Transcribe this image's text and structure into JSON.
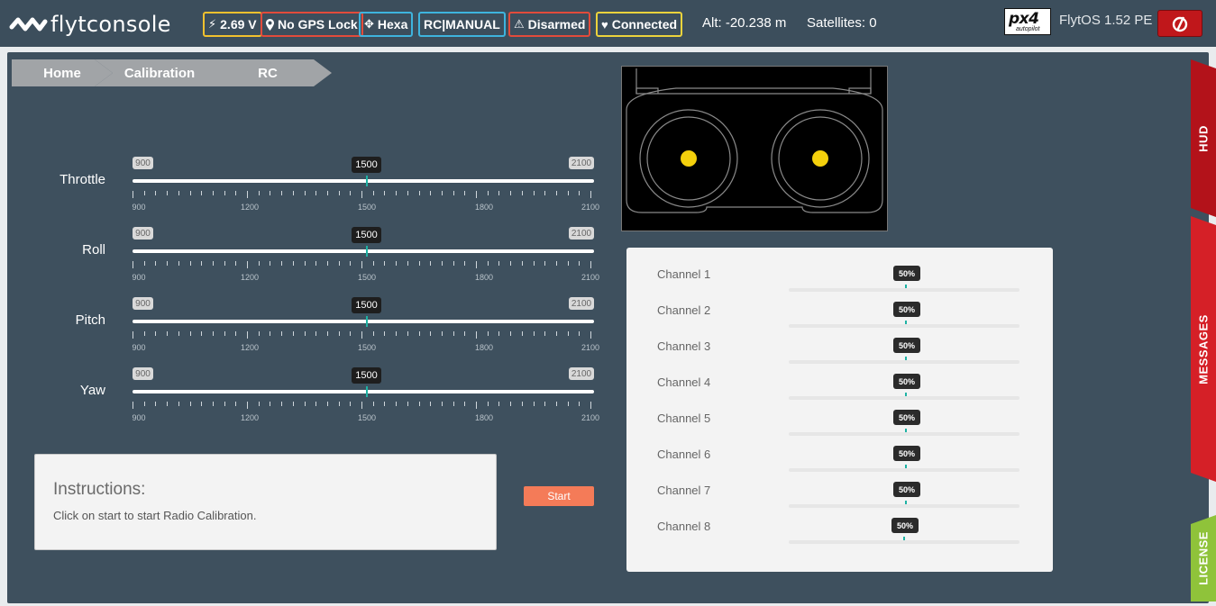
{
  "header": {
    "logo_text": "flytconsole",
    "battery": "2.69 V",
    "gps": "No GPS Lock",
    "frame": "Hexa",
    "mode": "RC|MANUAL",
    "arm_state": "Disarmed",
    "link": "Connected",
    "altitude": "Alt: -20.238 m",
    "satellites": "Satellites: 0",
    "autopilot_logo_main": "px4",
    "autopilot_logo_sub": "autopilot",
    "os_version": "FlytOS 1.52 PE"
  },
  "breadcrumb": [
    "Home",
    "Calibration",
    "RC"
  ],
  "sliders": [
    {
      "label": "Throttle",
      "min": "900",
      "max": "2100",
      "value": "1500"
    },
    {
      "label": "Roll",
      "min": "900",
      "max": "2100",
      "value": "1500"
    },
    {
      "label": "Pitch",
      "min": "900",
      "max": "2100",
      "value": "1500"
    },
    {
      "label": "Yaw",
      "min": "900",
      "max": "2100",
      "value": "1500"
    }
  ],
  "slider_scale": [
    "900",
    "1200",
    "1500",
    "1800",
    "2100"
  ],
  "instructions": {
    "title": "Instructions:",
    "text": "Click on start to start Radio Calibration."
  },
  "start_label": "Start",
  "channels": [
    {
      "label": "Channel 1",
      "value": "50%"
    },
    {
      "label": "Channel 2",
      "value": "50%"
    },
    {
      "label": "Channel 3",
      "value": "50%"
    },
    {
      "label": "Channel 4",
      "value": "50%"
    },
    {
      "label": "Channel 5",
      "value": "50%"
    },
    {
      "label": "Channel 6",
      "value": "50%"
    },
    {
      "label": "Channel 7",
      "value": "50%"
    },
    {
      "label": "Channel 8",
      "value": "50%"
    }
  ],
  "side_tabs": {
    "hud": "HUD",
    "messages": "MESSAGES",
    "license": "LICENSE"
  },
  "colors": {
    "topbar": "#3c4e5c",
    "panel": "#3e505e",
    "accent": "#1fb3a4",
    "start_button": "#f47b58",
    "hud_tab": "#b3121a",
    "messages_tab": "#d52027",
    "license_tab": "#8fc33a",
    "stick_dot": "#f4d00c"
  },
  "icons": {
    "battery": "bolt-icon",
    "gps": "map-marker-icon",
    "frame": "move-arrows-icon",
    "arm": "warning-icon",
    "link": "heart-icon",
    "power": "power-icon"
  }
}
